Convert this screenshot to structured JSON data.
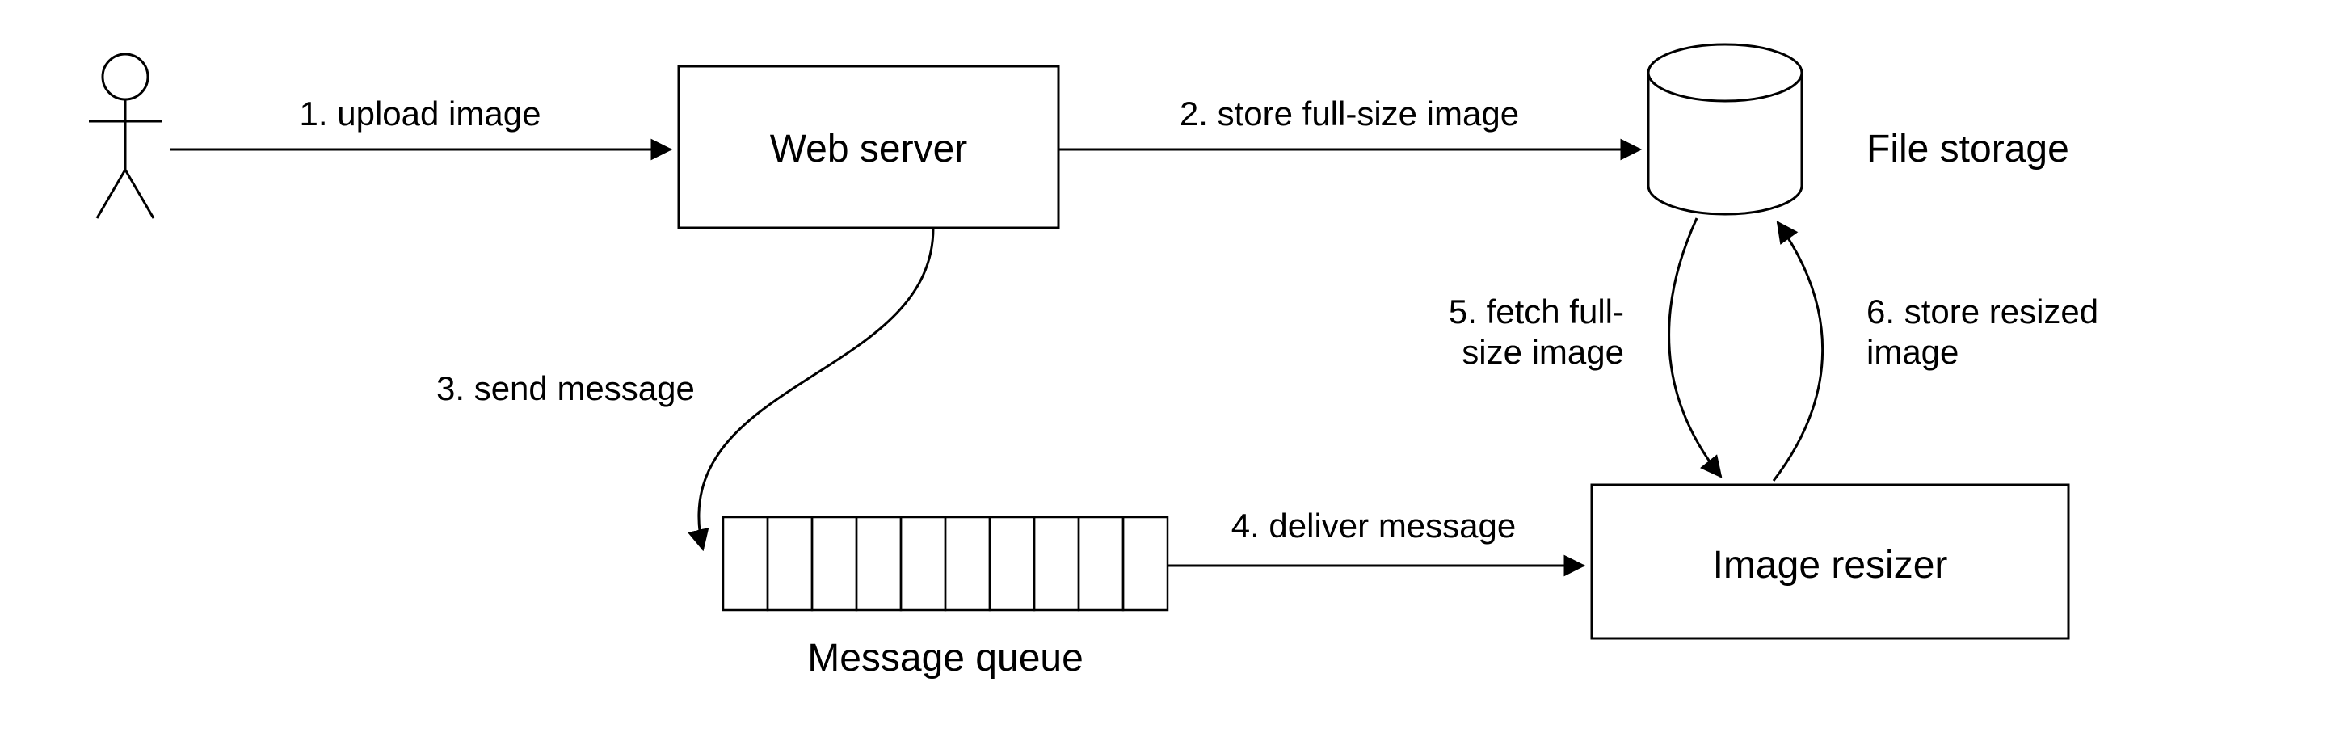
{
  "nodes": {
    "user": {
      "label": ""
    },
    "web_server": {
      "label": "Web server"
    },
    "file_storage": {
      "label": "File storage"
    },
    "message_queue": {
      "label": "Message queue"
    },
    "image_resizer": {
      "label": "Image resizer"
    }
  },
  "edges": {
    "upload": {
      "label": "1. upload image"
    },
    "store": {
      "label": "2. store full-size image"
    },
    "send": {
      "label": "3. send message"
    },
    "deliver": {
      "label": "4. deliver message"
    },
    "fetch": {
      "label_l1": "5. fetch full-",
      "label_l2": "size image"
    },
    "storeres": {
      "label_l1": "6. store resized",
      "label_l2": "image"
    }
  }
}
